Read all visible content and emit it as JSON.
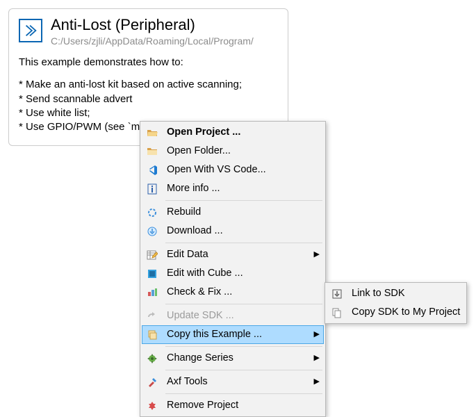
{
  "card": {
    "title": "Anti-Lost (Peripheral)",
    "path": "C:/Users/zjli/AppData/Roaming/Local/Program/",
    "intro": "This example demonstrates how to:",
    "bullets": [
      "* Make an anti-lost kit based on active scanning;",
      "* Send scannable advert",
      "* Use white list;",
      "* Use GPIO/PWM (see `m"
    ]
  },
  "menu": [
    {
      "icon": "open-project-icon",
      "label": "Open Project ...",
      "bold": true
    },
    {
      "icon": "open-folder-icon",
      "label": "Open Folder..."
    },
    {
      "icon": "vscode-icon",
      "label": "Open With VS Code..."
    },
    {
      "icon": "info-icon",
      "label": "More info ..."
    },
    {
      "sep": true
    },
    {
      "icon": "rebuild-icon",
      "label": "Rebuild"
    },
    {
      "icon": "download-icon",
      "label": "Download ..."
    },
    {
      "sep": true
    },
    {
      "icon": "edit-data-icon",
      "label": "Edit Data",
      "sub": true
    },
    {
      "icon": "cube-icon",
      "label": "Edit with Cube ..."
    },
    {
      "icon": "check-fix-icon",
      "label": "Check & Fix ..."
    },
    {
      "sep": true
    },
    {
      "icon": "update-sdk-icon",
      "label": "Update SDK ...",
      "disabled": true
    },
    {
      "icon": "copy-example-icon",
      "label": "Copy this Example ...",
      "sub": true,
      "highlight": true
    },
    {
      "sep": true
    },
    {
      "icon": "change-series-icon",
      "label": "Change Series",
      "sub": true
    },
    {
      "sep": true
    },
    {
      "icon": "axf-tools-icon",
      "label": "Axf Tools",
      "sub": true
    },
    {
      "sep": true
    },
    {
      "icon": "remove-project-icon",
      "label": "Remove Project"
    }
  ],
  "submenu": [
    {
      "icon": "link-sdk-icon",
      "label": "Link to SDK"
    },
    {
      "icon": "copy-sdk-icon",
      "label": "Copy SDK to My Project"
    }
  ],
  "arrow_glyph": "▶"
}
